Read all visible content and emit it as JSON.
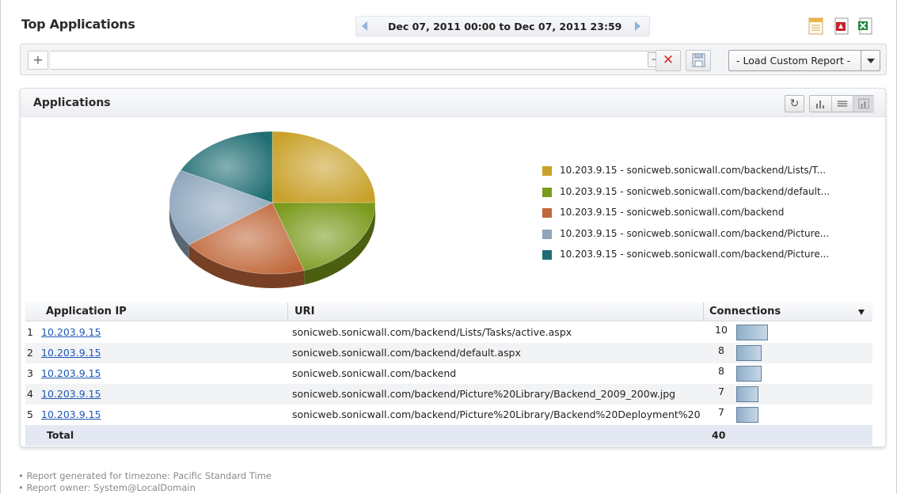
{
  "header": {
    "title": "Top Applications",
    "date_range": "Dec 07, 2011 00:00 to Dec 07, 2011 23:59"
  },
  "filter_bar": {
    "add_label": "+",
    "apply_label": "→",
    "clear_label": "✕",
    "custom_report_label": "- Load Custom Report -"
  },
  "panel": {
    "title": "Applications",
    "refresh_glyph": "↻"
  },
  "chart_data": {
    "type": "pie",
    "title": "",
    "slices": [
      {
        "label": "10.203.9.15 - sonicweb.sonicwall.com/backend/Lists/T...",
        "value": 10,
        "color": "#c9a12a"
      },
      {
        "label": "10.203.9.15 - sonicweb.sonicwall.com/backend/default...",
        "value": 8,
        "color": "#7a9a1c"
      },
      {
        "label": "10.203.9.15 - sonicweb.sonicwall.com/backend",
        "value": 8,
        "color": "#c0683a"
      },
      {
        "label": "10.203.9.15 - sonicweb.sonicwall.com/backend/Picture...",
        "value": 7,
        "color": "#8fa6bd"
      },
      {
        "label": "10.203.9.15 - sonicweb.sonicwall.com/backend/Picture...",
        "value": 7,
        "color": "#1f6e73"
      }
    ],
    "legend_position": "right"
  },
  "table": {
    "columns": [
      "Application IP",
      "URI",
      "Connections"
    ],
    "rows": [
      {
        "num": "1",
        "ip": "10.203.9.15",
        "uri": "sonicweb.sonicwall.com/backend/Lists/Tasks/active.aspx",
        "connections": "10",
        "value": 10
      },
      {
        "num": "2",
        "ip": "10.203.9.15",
        "uri": "sonicweb.sonicwall.com/backend/default.aspx",
        "connections": "8",
        "value": 8
      },
      {
        "num": "3",
        "ip": "10.203.9.15",
        "uri": "sonicweb.sonicwall.com/backend",
        "connections": "8",
        "value": 8
      },
      {
        "num": "4",
        "ip": "10.203.9.15",
        "uri": "sonicweb.sonicwall.com/backend/Picture%20Library/Backend_2009_200w.jpg",
        "connections": "7",
        "value": 7
      },
      {
        "num": "5",
        "ip": "10.203.9.15",
        "uri": "sonicweb.sonicwall.com/backend/Picture%20Library/Backend%20Deployment%20...",
        "connections": "7",
        "value": 7
      }
    ],
    "total_label": "Total",
    "total_value": "40"
  },
  "footnotes": [
    "• Report generated for timezone: Pacific Standard Time",
    "• Report owner: System@LocalDomain"
  ],
  "icons": {
    "prev": "chevron-left-icon",
    "next": "chevron-right-icon",
    "report": "report-icon",
    "pdf": "pdf-icon",
    "excel": "excel-icon",
    "save": "save-icon"
  }
}
